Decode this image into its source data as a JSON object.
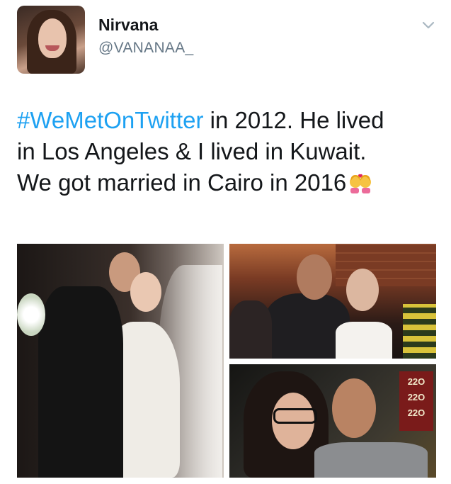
{
  "user": {
    "display_name": "Nirvana",
    "handle": "@VANANAA_"
  },
  "tweet": {
    "hashtag": "#WeMetOnTwitter",
    "line1_rest": " in 2012. He lived",
    "line2": "in Los Angeles & I lived in Kuwait.",
    "line3": "We got married in Cairo in 2016",
    "emoji": "couple-with-heart-emoji"
  },
  "colors": {
    "hashtag": "#1da1f2",
    "text": "#14171a",
    "secondary": "#657786"
  },
  "media": {
    "count": 3,
    "photo3_sign": [
      "22O",
      "22O",
      "22O"
    ]
  }
}
